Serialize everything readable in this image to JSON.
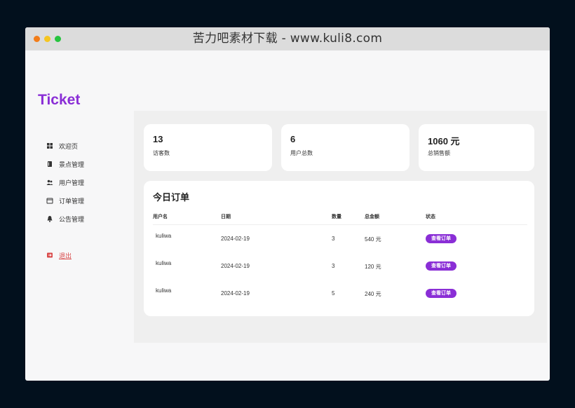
{
  "window": {
    "title": "苦力吧素材下载 - www.kuli8.com"
  },
  "app": {
    "brand": "Ticket"
  },
  "sidebar": {
    "items": [
      {
        "label": "欢迎页",
        "icon": "dashboard-icon"
      },
      {
        "label": "景点管理",
        "icon": "book-icon"
      },
      {
        "label": "用户管理",
        "icon": "users-icon"
      },
      {
        "label": "订单管理",
        "icon": "calendar-icon"
      },
      {
        "label": "公告管理",
        "icon": "bell-icon"
      }
    ],
    "logout": {
      "label": "退出",
      "icon": "logout-icon"
    }
  },
  "stats": [
    {
      "value": "13",
      "label": "访客数"
    },
    {
      "value": "6",
      "label": "用户总数"
    },
    {
      "value": "1060 元",
      "label": "总销售额"
    }
  ],
  "orders": {
    "title": "今日订单",
    "headers": [
      "用户名",
      "日期",
      "数量",
      "总金额",
      "状态"
    ],
    "rows": [
      {
        "user": "kuliwa",
        "date": "2024-02-19",
        "qty": "3",
        "total": "540 元",
        "action": "查看订单"
      },
      {
        "user": "kuliwa",
        "date": "2024-02-19",
        "qty": "3",
        "total": "120 元",
        "action": "查看订单"
      },
      {
        "user": "kuliwa",
        "date": "2024-02-19",
        "qty": "5",
        "total": "240 元",
        "action": "查看订单"
      }
    ]
  },
  "colors": {
    "accent": "#8a2ed6",
    "danger": "#d94b4b",
    "background": "#02101d"
  }
}
